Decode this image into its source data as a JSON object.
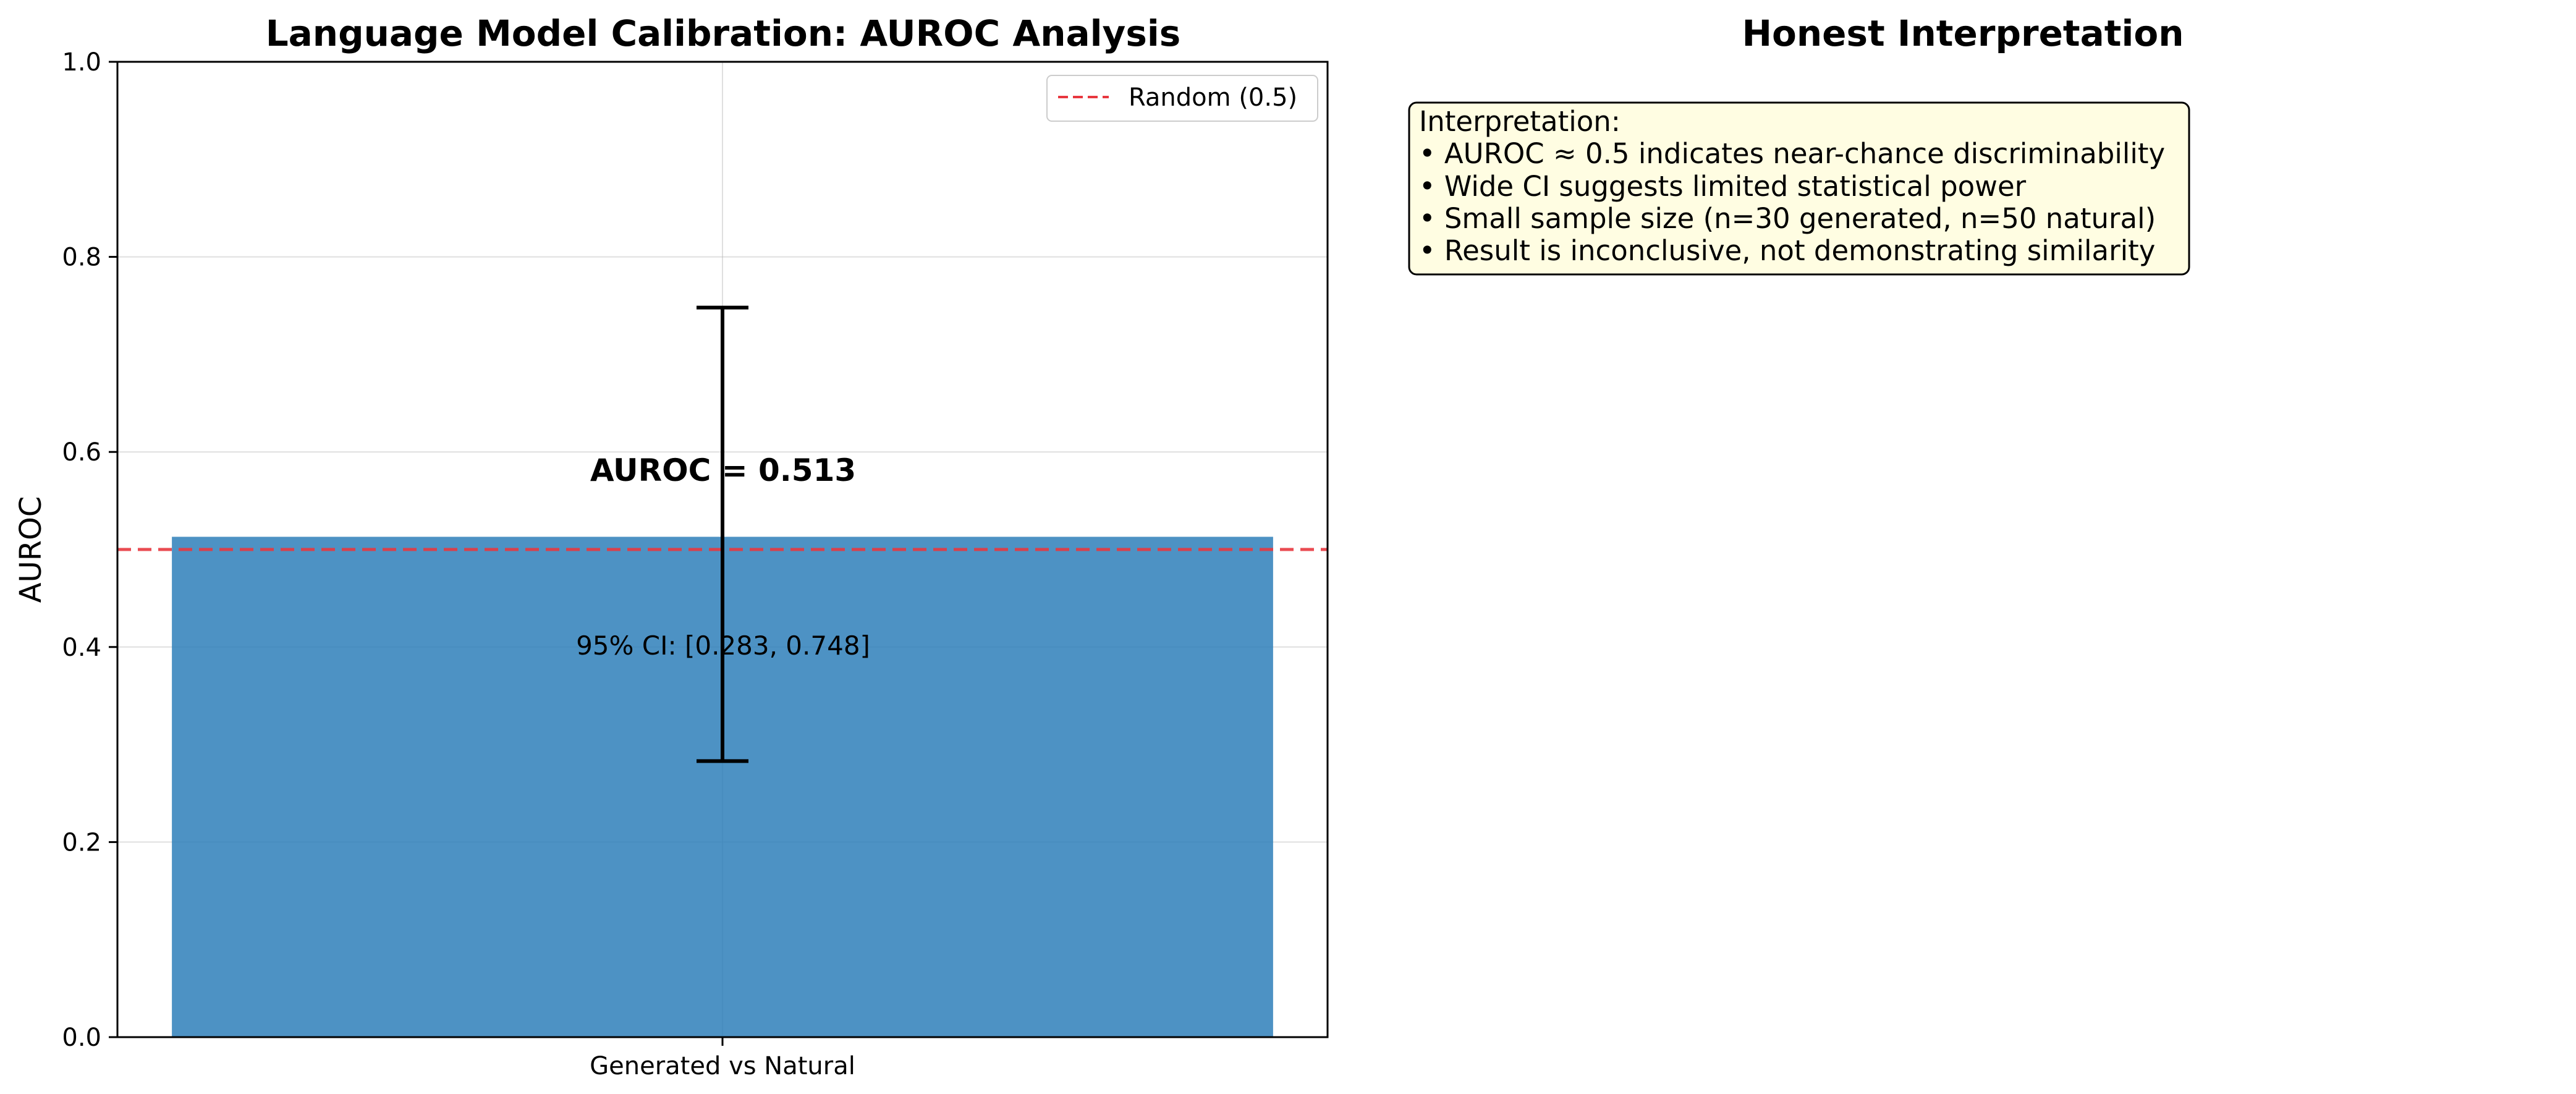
{
  "chart_data": {
    "type": "bar",
    "title": "Language Model Calibration: AUROC Analysis",
    "xlabel": "",
    "ylabel": "AUROC",
    "categories": [
      "Generated vs Natural"
    ],
    "values": [
      0.513
    ],
    "error_bars": [
      {
        "lower": 0.283,
        "upper": 0.748
      }
    ],
    "ylim": [
      0,
      1.0
    ],
    "yticks": [
      0.0,
      0.2,
      0.4,
      0.6,
      0.8,
      1.0
    ],
    "ytick_labels": [
      "0.0",
      "0.2",
      "0.4",
      "0.6",
      "0.8",
      "1.0"
    ],
    "grid": true,
    "bar_color": "#2e7fba",
    "reference_line": {
      "y": 0.5,
      "label": "Random (0.5)",
      "color": "#e8373f",
      "style": "dashed"
    },
    "legend_position": "top-right",
    "annotations": {
      "value_label": "AUROC = 0.513",
      "ci_label": "95% CI: [0.283, 0.748]"
    }
  },
  "interpretation_panel": {
    "title": "Honest Interpretation",
    "box_color": "#fffde2",
    "lines": [
      "Interpretation:",
      "• AUROC ≈ 0.5 indicates near-chance discriminability",
      "• Wide CI suggests limited statistical power",
      "• Small sample size (n=30 generated, n=50 natural)",
      "• Result is inconclusive, not demonstrating similarity"
    ]
  }
}
